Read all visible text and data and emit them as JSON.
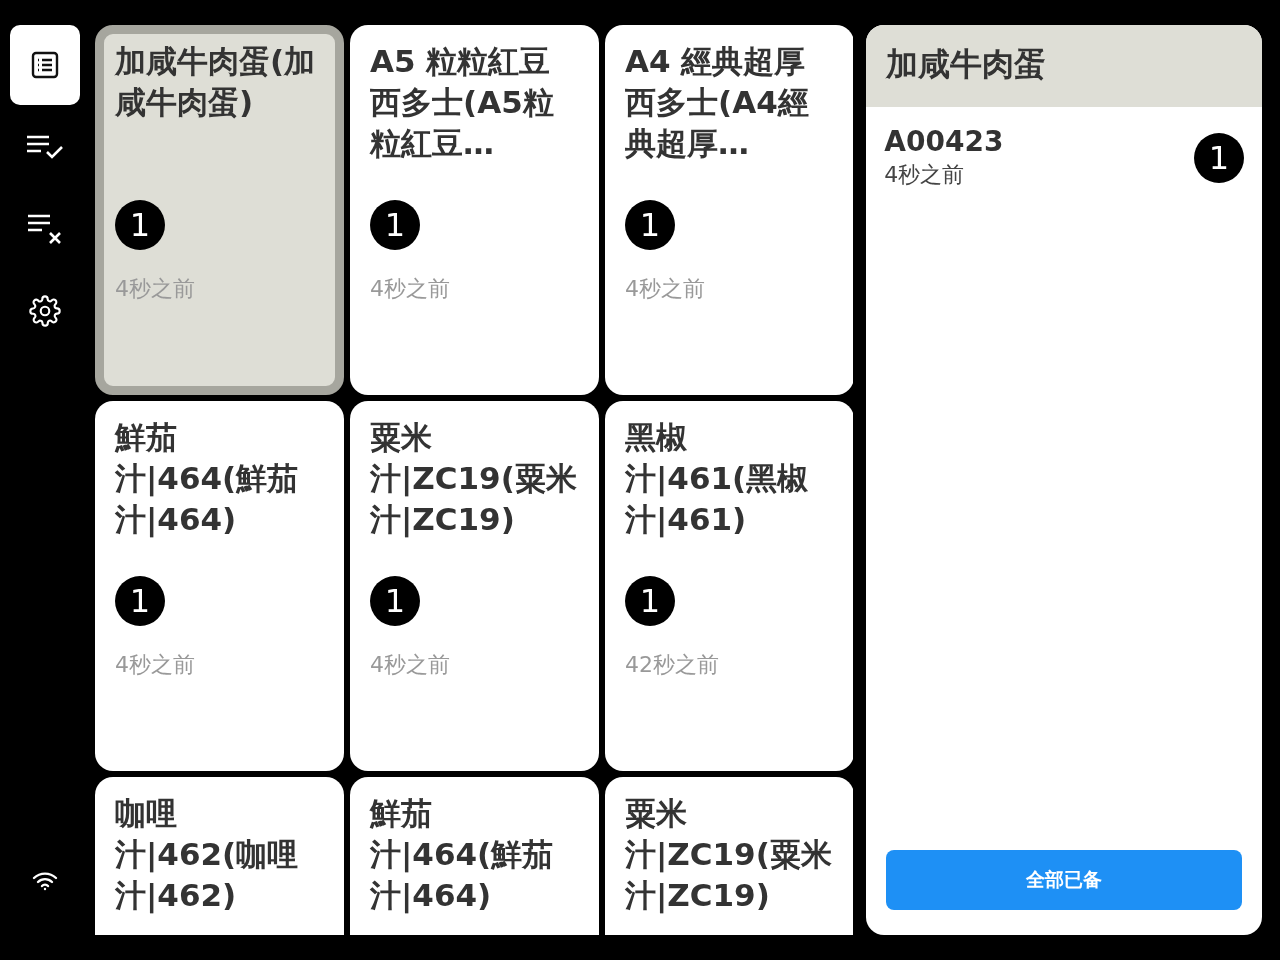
{
  "sidebar": {
    "items": [
      {
        "kind": "orders",
        "selected": true
      },
      {
        "kind": "completed",
        "selected": false
      },
      {
        "kind": "cancelled",
        "selected": false
      },
      {
        "kind": "settings",
        "selected": false
      }
    ]
  },
  "cards": [
    {
      "title": "加咸牛肉蛋(加咸牛肉蛋)",
      "count": "1",
      "time": "4秒之前",
      "selected": true
    },
    {
      "title": "A5 粒粒紅豆西多士(A5粒粒紅豆…",
      "count": "1",
      "time": "4秒之前",
      "selected": false
    },
    {
      "title": "A4 經典超厚西多士(A4經典超厚…",
      "count": "1",
      "time": "4秒之前",
      "selected": false
    },
    {
      "title": "鮮茄汁|464(鮮茄汁|464)",
      "count": "1",
      "time": "4秒之前",
      "selected": false
    },
    {
      "title": "粟米汁|ZC19(粟米汁|ZC19)",
      "count": "1",
      "time": "4秒之前",
      "selected": false
    },
    {
      "title": "黑椒汁|461(黑椒汁|461)",
      "count": "1",
      "time": "42秒之前",
      "selected": false
    },
    {
      "title": "咖哩汁|462(咖哩汁|462)",
      "selected": false
    },
    {
      "title": "鮮茄汁|464(鮮茄汁|464)",
      "selected": false
    },
    {
      "title": "粟米汁|ZC19(粟米汁|ZC19)",
      "selected": false
    }
  ],
  "detail": {
    "title": "加咸牛肉蛋",
    "orders": [
      {
        "number": "A00423",
        "time": "4秒之前",
        "count": "1"
      }
    ],
    "button": "全部已备"
  }
}
